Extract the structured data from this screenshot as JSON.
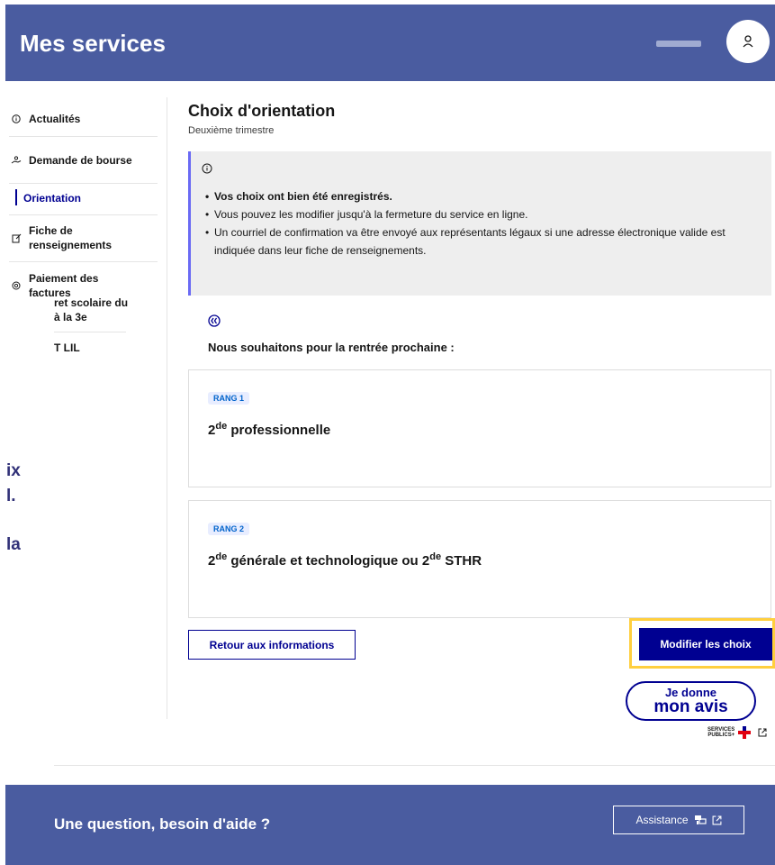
{
  "header": {
    "title": "Mes services"
  },
  "sidebar": {
    "items": [
      {
        "label": "Actualités",
        "icon": "info-circle-icon"
      },
      {
        "label": "Demande de bourse",
        "icon": "hand-coins-icon"
      },
      {
        "label": "Orientation",
        "icon": "",
        "active": true
      },
      {
        "label": "Fiche de renseignements",
        "icon": "edit-icon"
      },
      {
        "label": "Paiement des factures",
        "icon": "coin-icon"
      }
    ],
    "partial_items": [
      "ret scolaire du",
      "à la 3e",
      "T LIL"
    ]
  },
  "background_text": [
    "ix",
    "l.",
    "la"
  ],
  "main": {
    "title": "Choix d'orientation",
    "subtitle": "Deuxième trimestre",
    "info": [
      "Vos choix ont bien été enregistrés.",
      "Vous pouvez les modifier jusqu'à la fermeture du service en ligne.",
      "Un courriel de confirmation va être envoyé aux représentants légaux si une adresse électronique valide est indiquée dans leur fiche de renseignements."
    ],
    "intro": "Nous souhaitons pour la rentrée prochaine :",
    "choices": [
      {
        "rank": "RANG 1",
        "sup1": "de",
        "text": " professionnelle"
      },
      {
        "rank": "RANG 2",
        "sup1": "de",
        "text_mid": " générale et technologique ou 2",
        "sup2": "de",
        "text_end": " STHR"
      }
    ],
    "back_button": "Retour aux informations",
    "modify_button": "Modifier les choix"
  },
  "avis": {
    "line1": "Je donne",
    "line2": "mon avis",
    "brand_line1": "SERVICES",
    "brand_line2": "PUBLICS+"
  },
  "footer": {
    "title": "Une question, besoin d'aide ?",
    "assist_button": "Assistance"
  },
  "colors": {
    "header_bg": "#4a5ca0",
    "primary": "#000091",
    "highlight": "#ffcf3e",
    "info_border": "#6a6af4"
  }
}
